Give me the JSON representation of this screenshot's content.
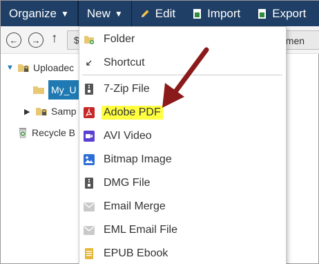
{
  "toolbar": {
    "organize": "Organize",
    "new": "New",
    "edit": "Edit",
    "import": "Import",
    "export": "Export"
  },
  "nav": {
    "path_prefix": "$",
    "path_tail": "cumen"
  },
  "tree": {
    "uploaded": "Uploadec",
    "my_u": "My_U",
    "samp": "Samp",
    "recycle": "Recycle B"
  },
  "menu": {
    "items": [
      {
        "label": "Folder",
        "icon": "folder-plus-icon"
      },
      {
        "label": "Shortcut",
        "icon": "shortcut-arrow-icon"
      },
      {
        "label": "7-Zip File",
        "icon": "zip-file-icon"
      },
      {
        "label": "Adobe PDF",
        "icon": "pdf-icon",
        "highlighted": true
      },
      {
        "label": "AVI Video",
        "icon": "video-icon"
      },
      {
        "label": "Bitmap Image",
        "icon": "image-icon"
      },
      {
        "label": "DMG File",
        "icon": "dmg-file-icon"
      },
      {
        "label": "Email Merge",
        "icon": "envelope-icon"
      },
      {
        "label": "EML Email File",
        "icon": "envelope-icon"
      },
      {
        "label": "EPUB Ebook",
        "icon": "ebook-icon"
      }
    ]
  },
  "colors": {
    "toolbar_bg": "#1f3f66",
    "selection": "#1f7ab3",
    "highlight": "#ffff40",
    "arrow": "#8b1a1a",
    "pdf_red": "#c62828",
    "video_purple": "#5b3fd1",
    "image_blue": "#2e6fd6"
  }
}
